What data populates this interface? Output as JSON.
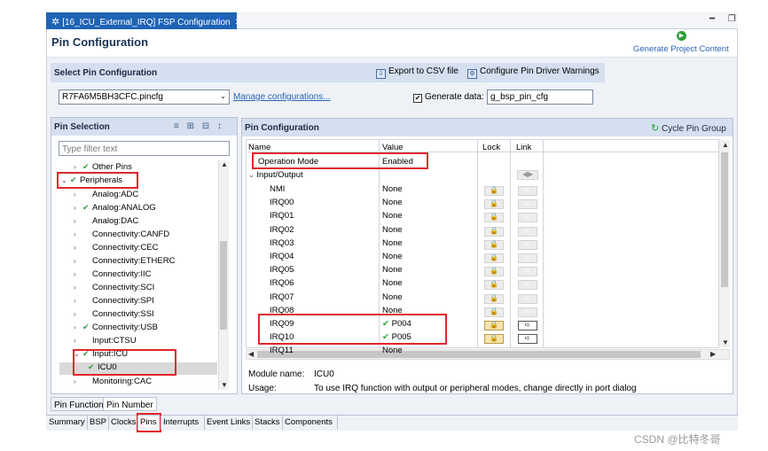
{
  "editor_tab": {
    "title": "[16_ICU_External_IRQ] FSP Configuration",
    "close": "✕"
  },
  "window_controls": "━ ❐",
  "header": {
    "title": "Pin Configuration",
    "generate_label": "Generate Project Content",
    "generate_icon": "play-icon"
  },
  "select_pin_config": {
    "title": "Select Pin Configuration",
    "export_label": "Export to CSV file",
    "configure_warnings_label": "Configure Pin Driver Warnings",
    "file_value": "R7FA6M5BH3CFC.pincfg",
    "manage_link": "Manage configurations...",
    "generate_data_label": "Generate data:",
    "generate_data_checked": true,
    "generate_data_value": "g_bsp_pin_cfg"
  },
  "pin_selection": {
    "title": "Pin Selection",
    "filter_placeholder": "Type filter text",
    "tree": [
      {
        "label": "Other Pins",
        "expand": "›",
        "check": "✔",
        "level": 1
      },
      {
        "label": "Peripherals",
        "expand": "⌄",
        "check": "✔",
        "level": 0
      },
      {
        "label": "Analog:ADC",
        "expand": "›",
        "check": "",
        "level": 1
      },
      {
        "label": "Analog:ANALOG",
        "expand": "›",
        "check": "✔",
        "level": 1
      },
      {
        "label": "Analog:DAC",
        "expand": "›",
        "check": "",
        "level": 1
      },
      {
        "label": "Connectivity:CANFD",
        "expand": "›",
        "check": "",
        "level": 1
      },
      {
        "label": "Connectivity:CEC",
        "expand": "›",
        "check": "",
        "level": 1
      },
      {
        "label": "Connectivity:ETHERC",
        "expand": "›",
        "check": "",
        "level": 1
      },
      {
        "label": "Connectivity:IIC",
        "expand": "›",
        "check": "",
        "level": 1
      },
      {
        "label": "Connectivity:SCI",
        "expand": "›",
        "check": "",
        "level": 1
      },
      {
        "label": "Connectivity:SPI",
        "expand": "›",
        "check": "",
        "level": 1
      },
      {
        "label": "Connectivity:SSI",
        "expand": "›",
        "check": "",
        "level": 1
      },
      {
        "label": "Connectivity:USB",
        "expand": "›",
        "check": "✔",
        "level": 1
      },
      {
        "label": "Input:CTSU",
        "expand": "›",
        "check": "",
        "level": 1
      },
      {
        "label": "Input:ICU",
        "expand": "⌄",
        "check": "✔",
        "level": 1
      },
      {
        "label": "ICU0",
        "expand": "",
        "check": "✔",
        "level": 2
      },
      {
        "label": "Monitoring:CAC",
        "expand": "›",
        "check": "",
        "level": 1
      }
    ],
    "sub_tabs": [
      "Pin Function",
      "Pin Number"
    ]
  },
  "pin_configuration": {
    "title": "Pin Configuration",
    "cycle_label": "Cycle Pin Group",
    "columns": [
      "Name",
      "Value",
      "Lock",
      "Link"
    ],
    "operation_mode": {
      "name": "Operation Mode",
      "value": "Enabled"
    },
    "group": {
      "name": "Input/Output",
      "expand": "⌄"
    },
    "rows": [
      {
        "name": "NMI",
        "value": "None",
        "active": false
      },
      {
        "name": "IRQ00",
        "value": "None",
        "active": false
      },
      {
        "name": "IRQ01",
        "value": "None",
        "active": false
      },
      {
        "name": "IRQ02",
        "value": "None",
        "active": false
      },
      {
        "name": "IRQ03",
        "value": "None",
        "active": false
      },
      {
        "name": "IRQ04",
        "value": "None",
        "active": false
      },
      {
        "name": "IRQ05",
        "value": "None",
        "active": false
      },
      {
        "name": "IRQ06",
        "value": "None",
        "active": false
      },
      {
        "name": "IRQ07",
        "value": "None",
        "active": false
      },
      {
        "name": "IRQ08",
        "value": "None",
        "active": false
      },
      {
        "name": "IRQ09",
        "value": "P004",
        "active": true
      },
      {
        "name": "IRQ10",
        "value": "P005",
        "active": true
      },
      {
        "name": "IRQ11",
        "value": "None",
        "active": false
      }
    ],
    "module_name_label": "Module name:",
    "module_name_value": "ICU0",
    "usage_label": "Usage:",
    "usage_value": "To use IRQ function with output or peripheral modes, change directly in port dialog"
  },
  "page_tabs": [
    "Summary",
    "BSP",
    "Clocks",
    "Pins",
    "Interrupts",
    "Event Links",
    "Stacks",
    "Components"
  ],
  "active_page_tab": "Pins",
  "watermark": "CSDN @比特冬哥",
  "icons": {
    "check": "✔",
    "lock": "🔒",
    "link_arrow": "➪",
    "link_pair": "◀▶",
    "scroll_up": "▲",
    "scroll_down": "▼",
    "scroll_left": "◀",
    "scroll_right": "▶",
    "select_arrow": "⌄",
    "editor_gear": "✲",
    "ps_tools": "≡ ⊞ ⊟ ↕",
    "cycle": "↻",
    "play": "▶",
    "export": "⇩",
    "configure": "⚙"
  },
  "colors": {
    "accent": "#1e63b5",
    "highlight": "#e0262c",
    "check_green": "#2e9c3a",
    "panel_header": "#d5dff0"
  }
}
